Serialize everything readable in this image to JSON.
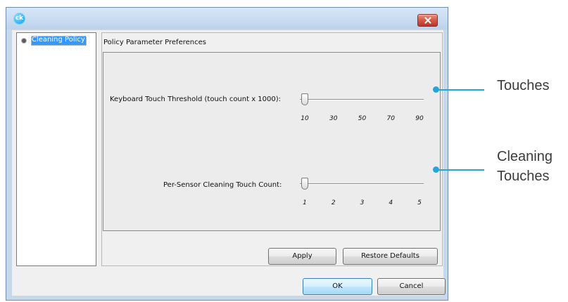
{
  "window": {
    "app_icon_text": "ck",
    "app_icon_color": "#39b8f0",
    "close_icon": "close-icon",
    "close_color": "#d85c47"
  },
  "tree": {
    "items": [
      {
        "label": "Cleaning Policy",
        "icon": "bullet-icon",
        "selected": true
      }
    ]
  },
  "panel": {
    "title": "Policy Parameter Preferences"
  },
  "settings": {
    "keyboard_touch_threshold": {
      "label": "Keyboard Touch Threshold (touch count x 1000):",
      "ticks": [
        "10",
        "30",
        "50",
        "70",
        "90"
      ],
      "value": 10,
      "min": 10,
      "max": 90
    },
    "per_sensor_cleaning_touch_count": {
      "label": "Per-Sensor Cleaning Touch Count:",
      "ticks": [
        "1",
        "2",
        "3",
        "4",
        "5"
      ],
      "value": 1,
      "min": 1,
      "max": 5
    }
  },
  "buttons": {
    "apply": "Apply",
    "restore_defaults": "Restore Defaults",
    "ok": "OK",
    "cancel": "Cancel"
  },
  "callouts": {
    "touches": "Touches",
    "cleaning_line1": "Cleaning",
    "cleaning_line2": "Touches",
    "color": "#24a5dc"
  }
}
